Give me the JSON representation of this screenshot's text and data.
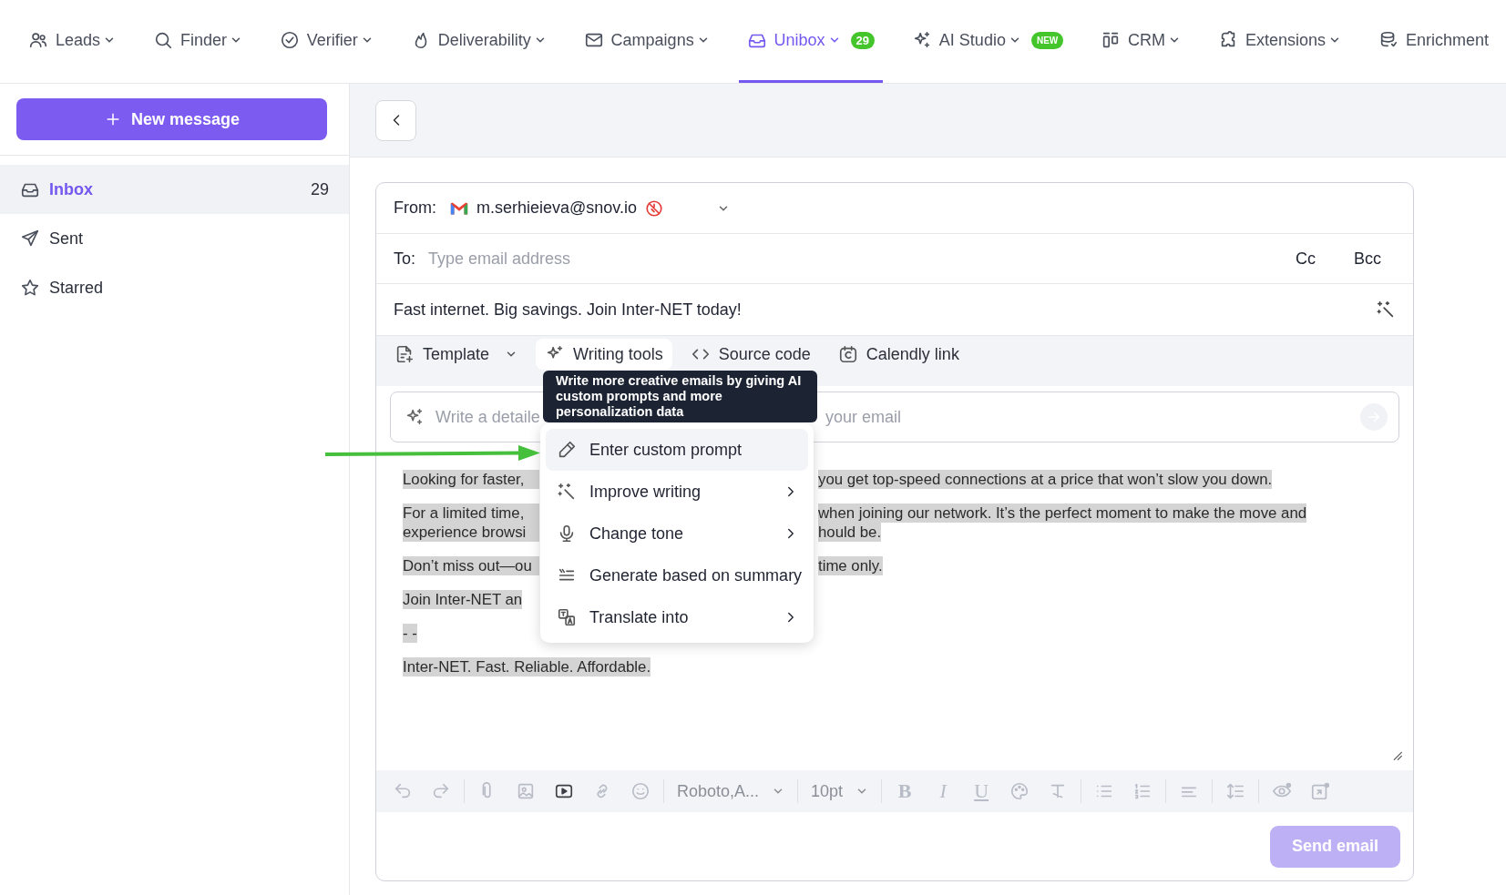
{
  "nav": [
    {
      "label": "Leads",
      "selected": false,
      "chevron": true
    },
    {
      "label": "Finder",
      "selected": false,
      "chevron": true
    },
    {
      "label": "Verifier",
      "selected": false,
      "chevron": true
    },
    {
      "label": "Deliverability",
      "selected": false,
      "chevron": true
    },
    {
      "label": "Campaigns",
      "selected": false,
      "chevron": true
    },
    {
      "label": "Unibox",
      "selected": true,
      "chevron": true,
      "badge": "29"
    },
    {
      "label": "AI Studio",
      "selected": false,
      "chevron": true,
      "badge": "NEW"
    },
    {
      "label": "CRM",
      "selected": false,
      "chevron": true
    },
    {
      "label": "Extensions",
      "selected": false,
      "chevron": true
    },
    {
      "label": "Enrichment",
      "selected": false,
      "chevron": false
    }
  ],
  "sidebar": {
    "new_message": "New message",
    "items": [
      {
        "label": "Inbox",
        "count": "29",
        "selected": true
      },
      {
        "label": "Sent",
        "selected": false
      },
      {
        "label": "Starred",
        "selected": false
      }
    ]
  },
  "compose": {
    "from_label": "From:",
    "from_email": "m.serhieieva@snov.io",
    "to_label": "To:",
    "to_placeholder": "Type email address",
    "cc": "Cc",
    "bcc": "Bcc",
    "subject": "Fast internet. Big savings. Join Inter-NET today!",
    "tools": [
      {
        "label": "Template",
        "selected": false
      },
      {
        "label": "Writing tools",
        "selected": true
      },
      {
        "label": "Source code",
        "selected": false
      },
      {
        "label": "Calendly link",
        "selected": false
      }
    ],
    "prompt_hint_parts": [
      "Write a detaile",
      "your email"
    ],
    "body": [
      {
        "left": "Looking for faster,",
        "right": "you get top-speed connections at a price that won’t slow you down."
      },
      {
        "left": "For a limited time,",
        "right": "when joining our network. It’s the perfect moment to make the move and"
      },
      {
        "left": "experience browsi",
        "right": "hould be.",
        "continued": true
      },
      {
        "left": "Don’t miss out—ou",
        "right": "time only."
      },
      {
        "left": "Join Inter-NET an"
      },
      {
        "left": "- -"
      },
      {
        "left": "Inter-NET. Fast. Reliable. Affordable."
      }
    ],
    "tooltip": "Write more creative emails by giving AI custom prompts and more personalization data",
    "menu": [
      {
        "label": "Enter custom prompt",
        "selected": true,
        "submenu": false
      },
      {
        "label": "Improve writing",
        "selected": false,
        "submenu": true
      },
      {
        "label": "Change tone",
        "selected": false,
        "submenu": true
      },
      {
        "label": "Generate based on summary",
        "selected": false,
        "submenu": false
      },
      {
        "label": "Translate into",
        "selected": false,
        "submenu": true
      }
    ],
    "font": "Roboto,A...",
    "size": "10pt",
    "format_letters": [
      "B",
      "I",
      "U"
    ],
    "send": {
      "label": "Send email",
      "disabled": true
    }
  }
}
